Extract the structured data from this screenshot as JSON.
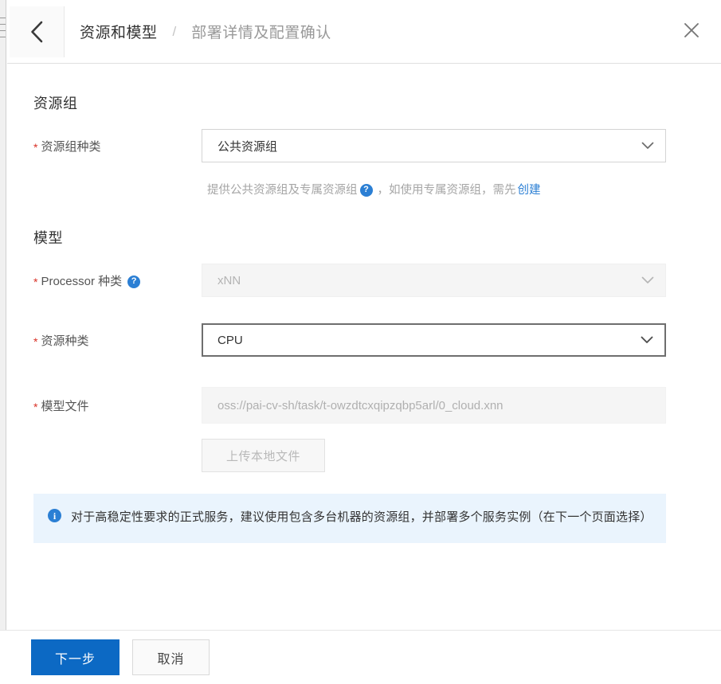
{
  "header": {
    "back_icon": "chevron-left-icon",
    "breadcrumb_current": "资源和模型",
    "breadcrumb_separator": "/",
    "breadcrumb_next": "部署详情及配置确认",
    "close_icon": "close-icon"
  },
  "sections": {
    "resource_group_title": "资源组",
    "model_title": "模型"
  },
  "fields": {
    "resource_group_type": {
      "label": "资源组种类",
      "required_marker": "*",
      "value": "公共资源组",
      "chevron_icon": "chevron-down-icon"
    },
    "resource_group_hint": {
      "prefix": "提供公共资源组及专属资源组",
      "help_icon_label": "?",
      "middle": "，如使用专属资源组，需先",
      "link": "创建"
    },
    "processor_type": {
      "label": "Processor 种类",
      "required_marker": "*",
      "help_icon_label": "?",
      "value": "xNN",
      "chevron_icon": "chevron-down-icon",
      "disabled": true
    },
    "resource_type": {
      "label": "资源种类",
      "required_marker": "*",
      "value": "CPU",
      "chevron_icon": "chevron-down-icon",
      "focused": true
    },
    "model_file": {
      "label": "模型文件",
      "required_marker": "*",
      "value": "oss://pai-cv-sh/task/t-owzdtcxqipzqbp5arl/0_cloud.xnn",
      "upload_button": "上传本地文件"
    }
  },
  "info_banner": {
    "icon": "info-icon",
    "text": "对于高稳定性要求的正式服务，建议使用包含多台机器的资源组，并部署多个服务实例（在下一个页面选择）"
  },
  "footer": {
    "next_label": "下一步",
    "cancel_label": "取消"
  },
  "colors": {
    "primary": "#0c69c4",
    "link": "#2b7fd4",
    "required": "#d93026",
    "banner_bg": "#eaf4fd",
    "disabled_bg": "#f5f5f5"
  }
}
